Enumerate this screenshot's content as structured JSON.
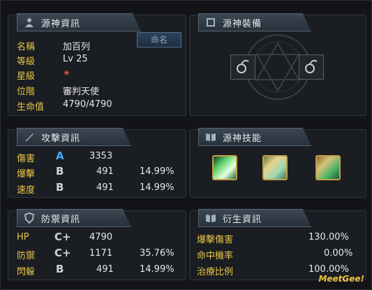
{
  "info": {
    "title": "源神資訊",
    "rename_label": "命名",
    "rows": [
      {
        "label": "名稱",
        "value": "加百列"
      },
      {
        "label": "等級",
        "value": "Lv 25"
      },
      {
        "label": "星級",
        "value": "★"
      },
      {
        "label": "位階",
        "value": "審判天使"
      },
      {
        "label": "生命值",
        "value": "4790/4790"
      }
    ]
  },
  "equip": {
    "title": "源神裝備"
  },
  "attack": {
    "title": "攻擊資訊",
    "rows": [
      {
        "label": "傷害",
        "grade": "A",
        "value": "3353",
        "pct": ""
      },
      {
        "label": "爆擊",
        "grade": "B",
        "value": "491",
        "pct": "14.99%"
      },
      {
        "label": "速度",
        "grade": "B",
        "value": "491",
        "pct": "14.99%"
      }
    ]
  },
  "skills": {
    "title": "源神技能"
  },
  "defense": {
    "title": "防禦資訊",
    "rows": [
      {
        "label": "HP",
        "grade": "C+",
        "value": "4790",
        "pct": ""
      },
      {
        "label": "防禦",
        "grade": "C+",
        "value": "1171",
        "pct": "35.76%"
      },
      {
        "label": "閃躲",
        "grade": "B",
        "value": "491",
        "pct": "14.99%"
      }
    ]
  },
  "derived": {
    "title": "衍生資訊",
    "rows": [
      {
        "label": "爆擊傷害",
        "value": "130.00%"
      },
      {
        "label": "命中機率",
        "value": "0.00%"
      },
      {
        "label": "治療比例",
        "value": "100.00%"
      }
    ]
  },
  "brand": "MeetGee!"
}
